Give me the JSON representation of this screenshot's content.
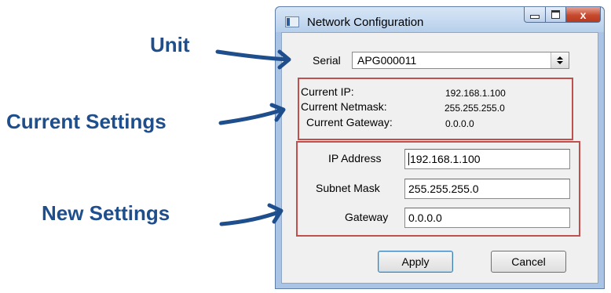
{
  "callouts": {
    "unit": "Unit",
    "current_settings": "Current Settings",
    "new_settings": "New Settings"
  },
  "window": {
    "title": "Network Configuration",
    "close_glyph": "x"
  },
  "serial": {
    "label": "Serial",
    "selected": "APG000011"
  },
  "current": {
    "ip_label": "Current IP:",
    "ip_value": "192.168.1.100",
    "netmask_label": "Current Netmask:",
    "netmask_value": "255.255.255.0",
    "gateway_label": "Current Gateway:",
    "gateway_value": "0.0.0.0"
  },
  "new_settings": {
    "ip_label": "IP Address",
    "ip_value": "192.168.1.100",
    "mask_label": "Subnet Mask",
    "mask_value": "255.255.255.0",
    "gateway_label": "Gateway",
    "gateway_value": "0.0.0.0"
  },
  "buttons": {
    "apply": "Apply",
    "cancel": "Cancel"
  },
  "colors": {
    "callout_text": "#1f4e8c",
    "highlight_box": "#c0504d",
    "close_button": "#c74a2f"
  }
}
